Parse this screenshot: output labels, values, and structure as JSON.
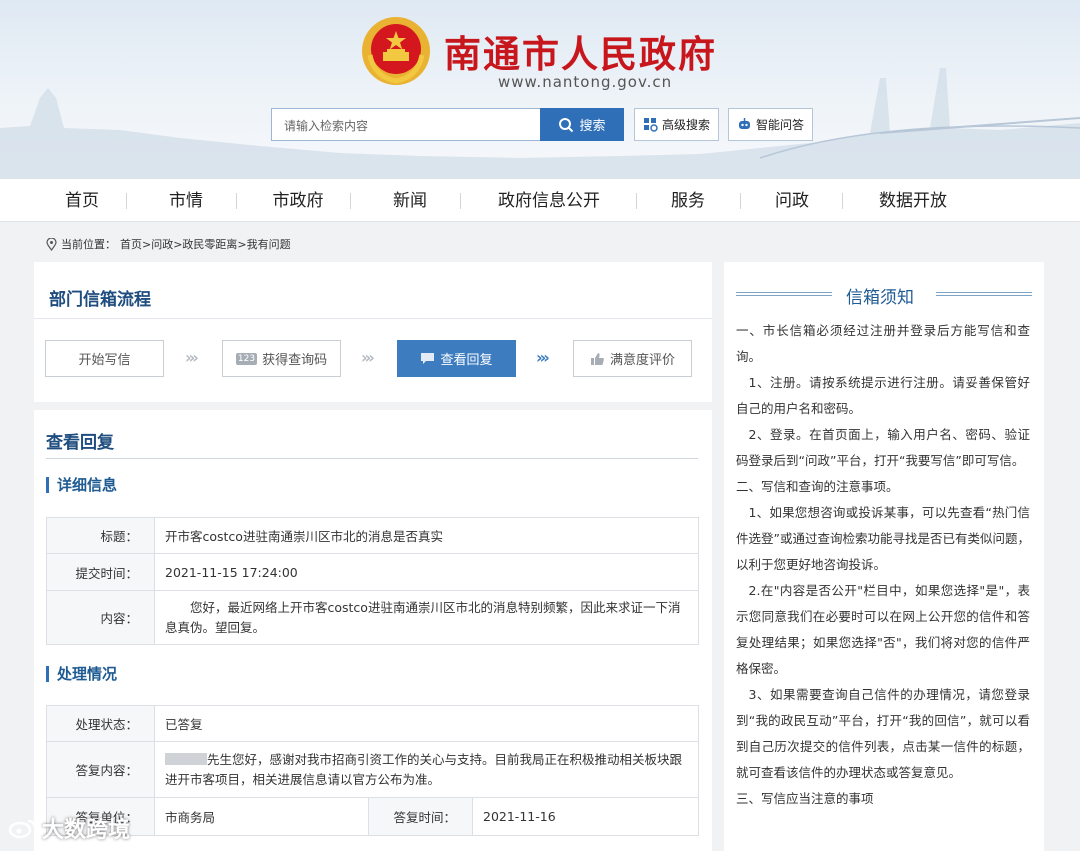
{
  "header": {
    "site_title": "南通市人民政府",
    "site_url": "www.nantong.gov.cn",
    "search_placeholder": "请输入检索内容",
    "search_button": "搜索",
    "advanced_search": "高级搜索",
    "smart_qa": "智能问答"
  },
  "nav": [
    "首页",
    "市情",
    "市政府",
    "新闻",
    "政府信息公开",
    "服务",
    "问政",
    "数据开放"
  ],
  "breadcrumb": {
    "prefix": "当前位置：",
    "path": "首页>问政>政民零距离>我有问题"
  },
  "process": {
    "title": "部门信箱流程",
    "steps": [
      {
        "label": "开始写信",
        "active": false
      },
      {
        "label": "获得查询码",
        "active": false
      },
      {
        "label": "查看回复",
        "active": true
      },
      {
        "label": "满意度评价",
        "active": false
      }
    ],
    "code_badge": "123"
  },
  "reply": {
    "title": "查看回复",
    "detail_heading": "详细信息",
    "rows": [
      {
        "label": "标题：",
        "value": "开市客costco进驻南通崇川区市北的消息是否真实"
      },
      {
        "label": "提交时间：",
        "value": "2021-11-15 17:24:00"
      },
      {
        "label": "内容：",
        "value": "您好，最近网络上开市客costco进驻南通崇川区市北的消息特别频繁，因此来求证一下消息真伪。望回复。"
      }
    ],
    "handling_heading": "处理情况",
    "status_label": "处理状态：",
    "status_value": "已答复",
    "answer_label": "答复内容：",
    "answer_value": "先生您好，感谢对我市招商引资工作的关心与支持。目前我局正在积极推动相关板块跟进开市客项目，相关进展信息请以官方公布为准。",
    "unit_label": "答复单位：",
    "unit_value": "市商务局",
    "time_label": "答复时间：",
    "time_value": "2021-11-16"
  },
  "notice": {
    "title": "信箱须知",
    "paragraphs": [
      {
        "text": "一、市长信箱必须经过注册并登录后方能写信和查询。",
        "indent": false
      },
      {
        "text": "1、注册。请按系统提示进行注册。请妥善保管好自己的用户名和密码。",
        "indent": true
      },
      {
        "text": "2、登录。在首页面上，输入用户名、密码、验证码登录后到“问政”平台，打开“我要写信”即可写信。",
        "indent": true
      },
      {
        "text": "二、写信和查询的注意事项。",
        "indent": false
      },
      {
        "text": "1、如果您想咨询或投诉某事，可以先查看“热门信件选登”或通过查询检索功能寻找是否已有类似问题，以利于您更好地咨询投诉。",
        "indent": true
      },
      {
        "text": "2.在\"内容是否公开\"栏目中，如果您选择\"是\"，表示您同意我们在必要时可以在网上公开您的信件和答复处理结果；如果您选择\"否\"，我们将对您的信件严格保密。",
        "indent": true
      },
      {
        "text": "3、如果需要查询自己信件的办理情况，请您登录到“我的政民互动”平台，打开“我的回信”，就可以看到自己历次提交的信件列表，点击某一信件的标题，就可查看该信件的办理状态或答复意见。",
        "indent": true
      },
      {
        "text": "三、写信应当注意的事项",
        "indent": false
      }
    ]
  },
  "watermark": "大数跨境",
  "colors": {
    "brand_red": "#c8161d",
    "primary_blue": "#2f6fb8",
    "title_blue": "#1f4d7f"
  }
}
